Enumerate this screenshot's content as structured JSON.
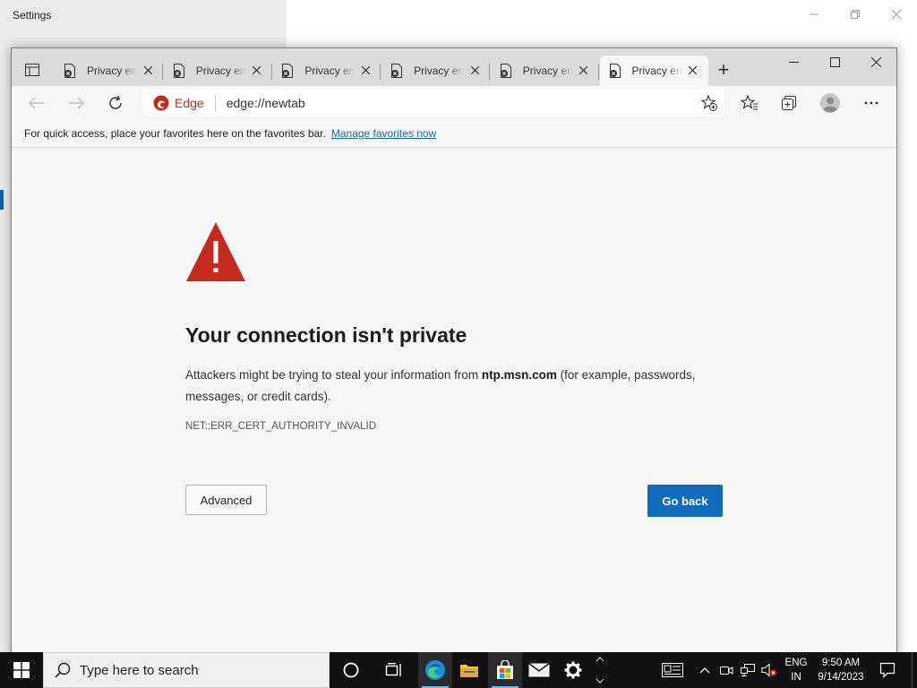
{
  "settings_window": {
    "title": "Settings",
    "controls": [
      "—",
      "❐",
      "✕"
    ]
  },
  "browser": {
    "tabs": [
      {
        "label": "Privacy error",
        "active": false
      },
      {
        "label": "Privacy error",
        "active": false
      },
      {
        "label": "Privacy error",
        "active": false
      },
      {
        "label": "Privacy error",
        "active": false
      },
      {
        "label": "Privacy error",
        "active": false
      },
      {
        "label": "Privacy error",
        "active": true
      }
    ],
    "address": {
      "site_label": "Edge",
      "url": "edge://newtab"
    },
    "favorites_bar": {
      "message": "For quick access, place your favorites here on the favorites bar.",
      "link": "Manage favorites now"
    },
    "error_page": {
      "title": "Your connection isn't private",
      "description_before": "Attackers might be trying to steal your information from ",
      "host": "ntp.msn.com",
      "description_after": " (for example, passwords, messages, or credit cards).",
      "error_code": "NET::ERR_CERT_AUTHORITY_INVALID",
      "advanced_label": "Advanced",
      "go_back_label": "Go back"
    },
    "colors": {
      "accent": "#0f6cbd",
      "warning": "#c42b1c"
    }
  },
  "taskbar": {
    "search_placeholder": "Type here to search",
    "language": "ENG",
    "region": "IN",
    "time": "9:50 AM",
    "date": "9/14/2023"
  }
}
